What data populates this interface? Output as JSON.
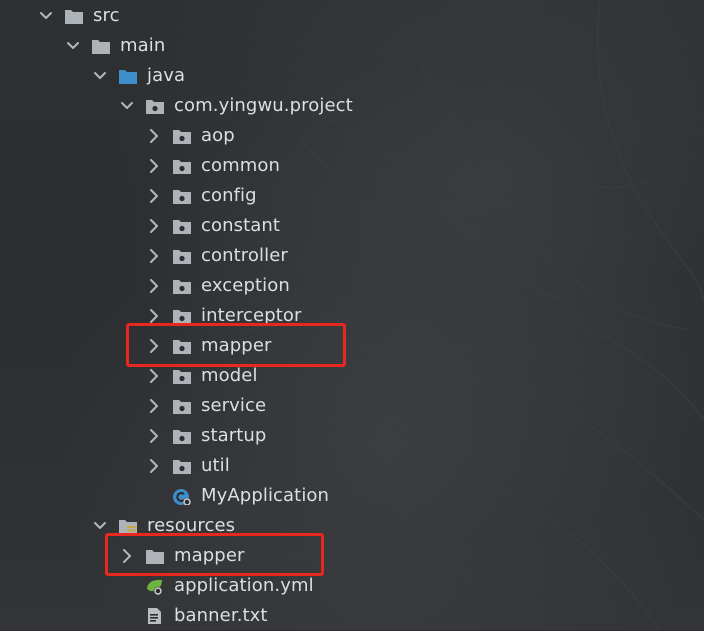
{
  "tree": [
    {
      "label": "src",
      "depth": 0,
      "expanded": true,
      "icon": "folder-icon"
    },
    {
      "label": "main",
      "depth": 1,
      "expanded": true,
      "icon": "folder-icon"
    },
    {
      "label": "java",
      "depth": 2,
      "expanded": true,
      "icon": "source-root-folder-icon"
    },
    {
      "label": "com.yingwu.project",
      "depth": 3,
      "expanded": true,
      "icon": "package-icon"
    },
    {
      "label": "aop",
      "depth": 4,
      "expanded": false,
      "icon": "package-icon"
    },
    {
      "label": "common",
      "depth": 4,
      "expanded": false,
      "icon": "package-icon"
    },
    {
      "label": "config",
      "depth": 4,
      "expanded": false,
      "icon": "package-icon"
    },
    {
      "label": "constant",
      "depth": 4,
      "expanded": false,
      "icon": "package-icon"
    },
    {
      "label": "controller",
      "depth": 4,
      "expanded": false,
      "icon": "package-icon"
    },
    {
      "label": "exception",
      "depth": 4,
      "expanded": false,
      "icon": "package-icon"
    },
    {
      "label": "interceptor",
      "depth": 4,
      "expanded": false,
      "icon": "package-icon"
    },
    {
      "label": "mapper",
      "depth": 4,
      "expanded": false,
      "icon": "package-icon",
      "highlighted": true
    },
    {
      "label": "model",
      "depth": 4,
      "expanded": false,
      "icon": "package-icon"
    },
    {
      "label": "service",
      "depth": 4,
      "expanded": false,
      "icon": "package-icon"
    },
    {
      "label": "startup",
      "depth": 4,
      "expanded": false,
      "icon": "package-icon"
    },
    {
      "label": "util",
      "depth": 4,
      "expanded": false,
      "icon": "package-icon"
    },
    {
      "label": "MyApplication",
      "depth": 4,
      "expanded": null,
      "icon": "spring-boot-class-icon"
    },
    {
      "label": "resources",
      "depth": 2,
      "expanded": true,
      "icon": "resources-folder-icon"
    },
    {
      "label": "mapper",
      "depth": 3,
      "expanded": false,
      "icon": "folder-icon",
      "highlighted": true
    },
    {
      "label": "application.yml",
      "depth": 3,
      "expanded": null,
      "icon": "spring-config-icon"
    },
    {
      "label": "banner.txt",
      "depth": 3,
      "expanded": null,
      "icon": "text-file-icon"
    }
  ],
  "colors": {
    "background": "#2b2d30",
    "text": "#dcdedf",
    "icon_gray": "#aeb3b8",
    "icon_blue": "#3d8ec9",
    "highlight_red": "#e8271f",
    "spring_green": "#6db33f"
  }
}
